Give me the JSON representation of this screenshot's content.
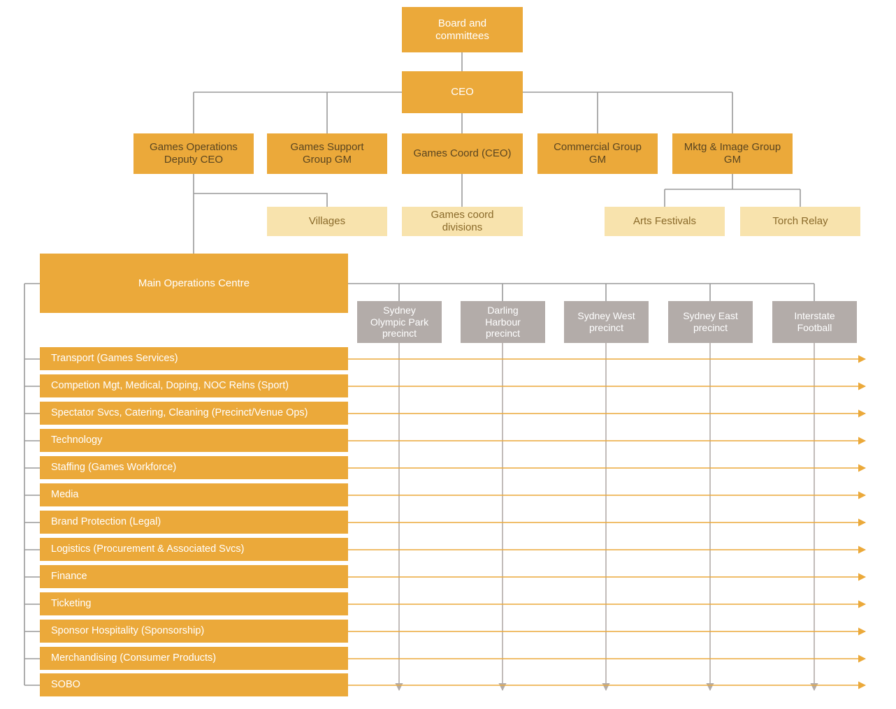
{
  "diagram": {
    "title": "Games organisation structure chart",
    "colors": {
      "primary_orange": "#eba93a",
      "light_orange": "#f8e3ad",
      "grey": "#b3aca9",
      "connector_grey": "#9a9a9a",
      "connector_orange": "#eba93a",
      "white_text": "#ffffff",
      "dark_text": "#5a4520",
      "light_box_text": "#8a6a2a"
    }
  },
  "top": {
    "board": "Board and\ncommittees",
    "ceo": "CEO"
  },
  "groups": [
    {
      "label": "Games Operations\nDeputy CEO"
    },
    {
      "label": "Games Support\nGroup GM"
    },
    {
      "label": "Games Coord (CEO)"
    },
    {
      "label": "Commercial Group\nGM"
    },
    {
      "label": "Mktg & Image Group\nGM"
    }
  ],
  "subunits": [
    {
      "label": "Villages"
    },
    {
      "label": "Games coord\ndivisions"
    },
    {
      "label": "Arts Festivals"
    },
    {
      "label": "Torch Relay"
    }
  ],
  "operations_centre": {
    "label": "Main Operations Centre"
  },
  "precincts": [
    {
      "label": "Sydney\nOlympic Park\nprecinct"
    },
    {
      "label": "Darling\nHarbour\nprecinct"
    },
    {
      "label": "Sydney West\nprecinct"
    },
    {
      "label": "Sydney East\nprecinct"
    },
    {
      "label": "Interstate\nFootball"
    }
  ],
  "functions": [
    {
      "label": "Transport (Games Services)"
    },
    {
      "label": "Competion Mgt, Medical, Doping, NOC Relns (Sport)"
    },
    {
      "label": "Spectator Svcs, Catering, Cleaning (Precinct/Venue Ops)"
    },
    {
      "label": "Technology"
    },
    {
      "label": "Staffing (Games Workforce)"
    },
    {
      "label": "Media"
    },
    {
      "label": "Brand Protection (Legal)"
    },
    {
      "label": "Logistics (Procurement & Associated Svcs)"
    },
    {
      "label": "Finance"
    },
    {
      "label": "Ticketing"
    },
    {
      "label": "Sponsor Hospitality (Sponsorship)"
    },
    {
      "label": "Merchandising (Consumer Products)"
    },
    {
      "label": "SOBO"
    }
  ]
}
